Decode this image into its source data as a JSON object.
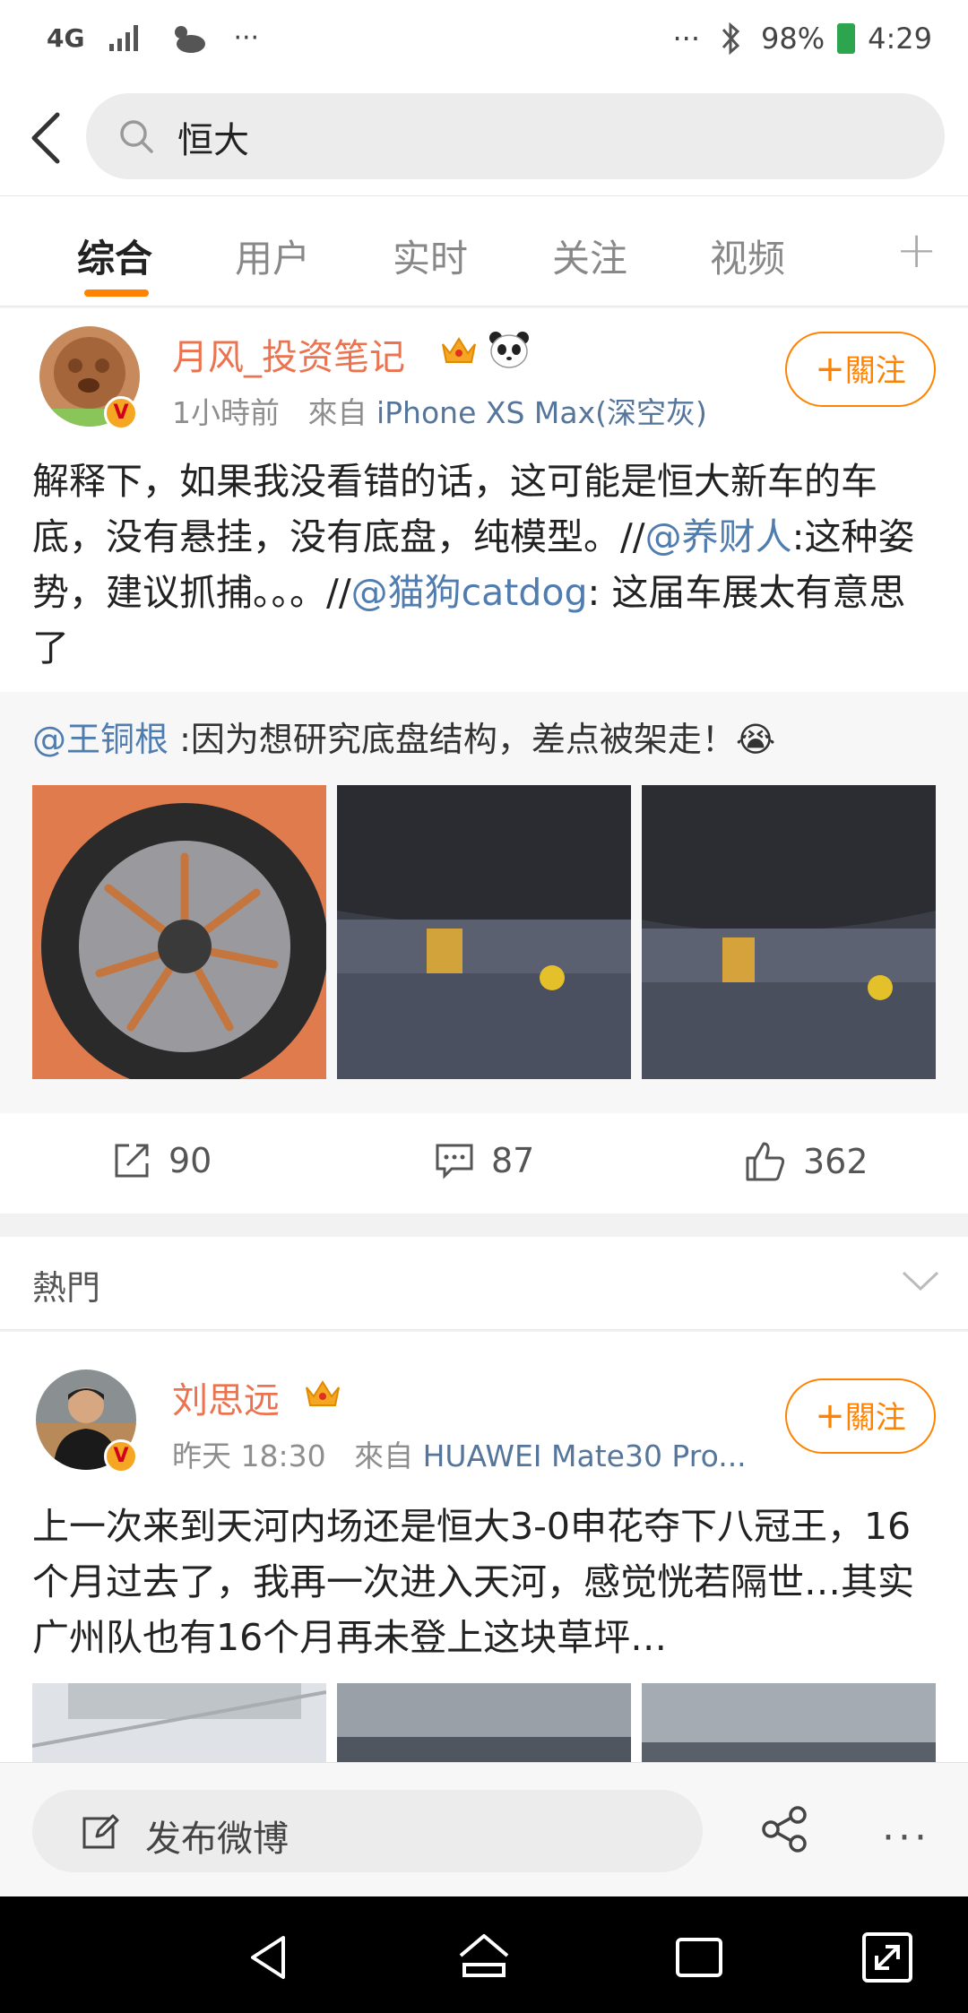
{
  "status_bar": {
    "network": "4G",
    "signal_icon": "signal-icon",
    "weather_icon": "cloud-sun-icon",
    "left_dots": "···",
    "right_dots": "···",
    "bluetooth_icon": "bluetooth-icon",
    "battery": "98%",
    "time": "4:29"
  },
  "search": {
    "query": "恒大"
  },
  "tabs": [
    {
      "label": "综合",
      "active": true
    },
    {
      "label": "用户"
    },
    {
      "label": "实时"
    },
    {
      "label": "关注"
    },
    {
      "label": "视频"
    }
  ],
  "tab_plus": "+",
  "post1": {
    "username": "月风_投资笔记",
    "time": "1小時前",
    "source_prefix": "來自",
    "source": "iPhone XS Max(深空灰)",
    "follow_label": "關注",
    "text_parts": {
      "a": "解释下，如果我没看错的话，这可能是恒大新车的车底，没有悬挂，没有底盘，纯模型。//",
      "m1": "@养财人",
      "b": ":这种姿势，建议抓捕。。。//",
      "m2": "@猫狗catdog",
      "c": ": 这届车展太有意思了"
    },
    "repost": {
      "mention": "@王铜根",
      "text": " :因为想研究底盘结构，差点被架走！",
      "emoji": "😭"
    },
    "reposts": "90",
    "comments": "87",
    "likes": "362"
  },
  "hot_label": "熱門",
  "post2": {
    "username": "刘思远",
    "time": "昨天 18:30",
    "source_prefix": "來自",
    "source": "HUAWEI Mate30 Pro...",
    "follow_label": "關注",
    "text": "上一次来到天河内场还是恒大3-0申花夺下八冠王，16个月过去了，我再一次进入天河，感觉恍若隔世…其实广州队也有16个月再未登上这块草坪…"
  },
  "compose": {
    "placeholder": "发布微博"
  },
  "colors": {
    "accent": "#ff8200",
    "username": "#eb7350",
    "link": "#507daf"
  }
}
